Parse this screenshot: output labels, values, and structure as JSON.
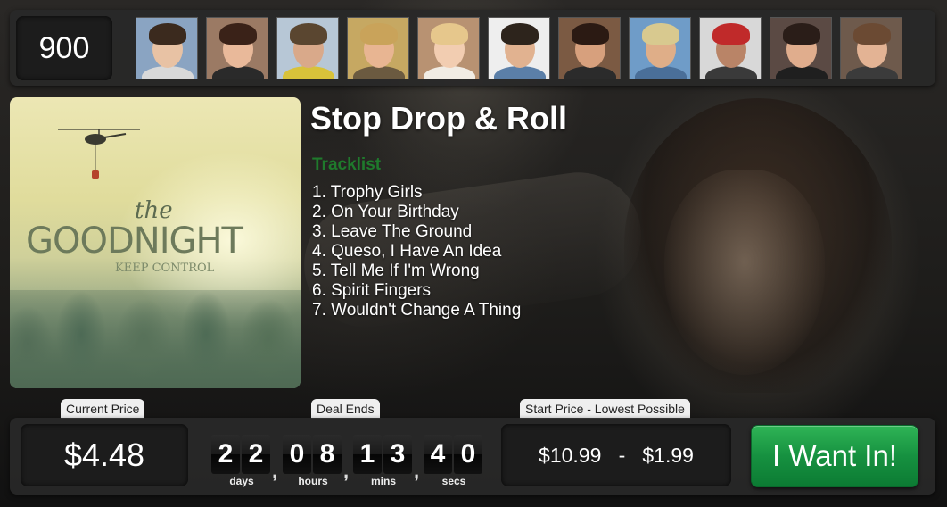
{
  "header": {
    "counter": "900",
    "avatars": [
      {
        "name": "avatar-1",
        "skin": "#e8c2a4",
        "hair": "#3b2a1e",
        "shirt": "#d9d9d9",
        "bg": "#8aa4c2"
      },
      {
        "name": "avatar-2",
        "skin": "#e9b99a",
        "hair": "#3a2218",
        "shirt": "#2a2a2a",
        "bg": "#9b7a64"
      },
      {
        "name": "avatar-3",
        "skin": "#d9a98a",
        "hair": "#5a4630",
        "shirt": "#d8c23a",
        "bg": "#b7c7d6"
      },
      {
        "name": "avatar-4",
        "skin": "#e8b592",
        "hair": "#c9a35a",
        "shirt": "#6b5a40",
        "bg": "#c6a862"
      },
      {
        "name": "avatar-5",
        "skin": "#f2cdb1",
        "hair": "#e6c78c",
        "shirt": "#f1ece4",
        "bg": "#b89272"
      },
      {
        "name": "avatar-6",
        "skin": "#e1b290",
        "hair": "#2d241c",
        "shirt": "#5b7fa8",
        "bg": "#eeeeee"
      },
      {
        "name": "avatar-7",
        "skin": "#d7a07d",
        "hair": "#2b1a13",
        "shirt": "#2b2b2b",
        "bg": "#7b5a43"
      },
      {
        "name": "avatar-8",
        "skin": "#dfae88",
        "hair": "#d8c98f",
        "shirt": "#4a6f99",
        "bg": "#6f9cc8"
      },
      {
        "name": "avatar-9",
        "skin": "#b98467",
        "hair": "#c02a2a",
        "shirt": "#3a3a3a",
        "bg": "#d8d8d8"
      },
      {
        "name": "avatar-10",
        "skin": "#e0ad8d",
        "hair": "#2a1d18",
        "shirt": "#1f1f1f",
        "bg": "#5b4a44"
      },
      {
        "name": "avatar-11",
        "skin": "#e3b394",
        "hair": "#6b4a33",
        "shirt": "#3b3b3b",
        "bg": "#6e5a4c"
      }
    ]
  },
  "album": {
    "logo_the": "the",
    "logo_main": "GOODNIGHT",
    "logo_sub": "KEEP CONTROL"
  },
  "deal": {
    "title": "Stop Drop & Roll",
    "tracklist_heading": "Tracklist",
    "tracks": [
      "1. Trophy Girls",
      "2. On Your Birthday",
      "3. Leave The Ground",
      "4. Queso, I Have An Idea",
      "5. Tell Me If I'm Wrong",
      "6. Spirit Fingers",
      "7. Wouldn't Change A Thing"
    ]
  },
  "footer": {
    "current_price_label": "Current Price",
    "current_price": "$4.48",
    "deal_ends_label": "Deal Ends",
    "countdown": {
      "days_digits": [
        "2",
        "2"
      ],
      "hours_digits": [
        "0",
        "8"
      ],
      "mins_digits": [
        "1",
        "3"
      ],
      "secs_digits": [
        "4",
        "0"
      ],
      "days_label": "days",
      "hours_label": "hours",
      "mins_label": "mins",
      "secs_label": "secs",
      "separator": ","
    },
    "range_label": "Start Price   -   Lowest Possible",
    "range_value": "$10.99   -   $1.99",
    "cta_label": "I Want In!"
  },
  "colors": {
    "accent_green": "#169140",
    "tracklist_green": "#1f7a2c"
  }
}
